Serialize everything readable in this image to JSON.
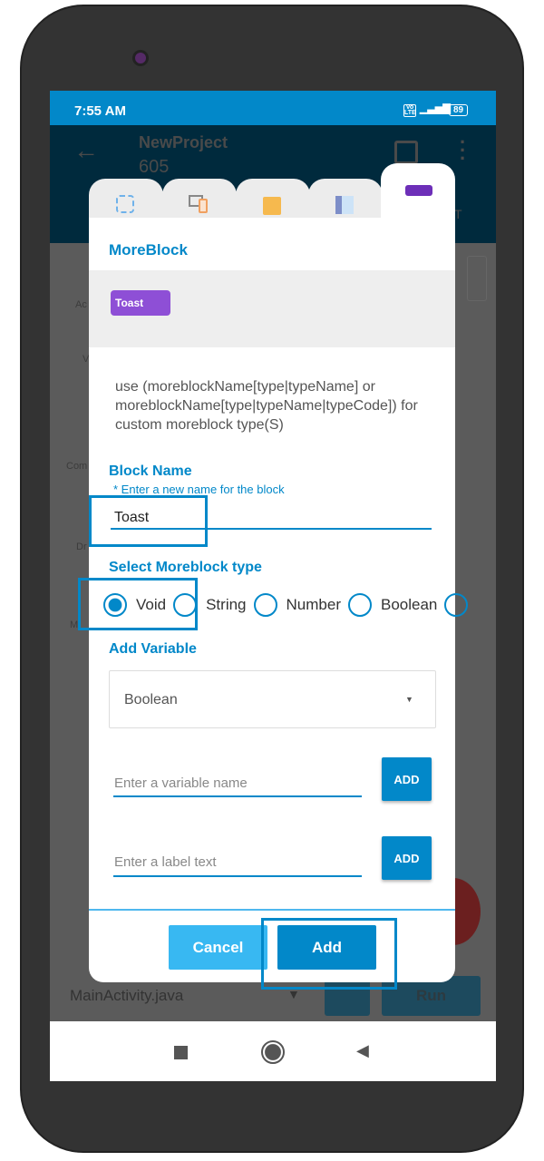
{
  "status": {
    "time": "7:55 AM",
    "volte": "Vo LTE",
    "battery": "89"
  },
  "appbar": {
    "title": "NewProject",
    "subtitle": "605",
    "tab_partial": "T"
  },
  "background_sidebar": [
    "Ac",
    "V",
    "Com",
    "Dr",
    "M"
  ],
  "bottom_bar": {
    "file": "MainActivity.java",
    "run": "Run"
  },
  "dialog": {
    "tabs": [
      {
        "icon": "refresh-icon"
      },
      {
        "icon": "devices-icon"
      },
      {
        "icon": "box-icon"
      },
      {
        "icon": "layout-icon"
      },
      {
        "icon": "moreblock-icon",
        "active": true
      }
    ],
    "title": "MoreBlock",
    "preview_block": "Toast",
    "description": "use (moreblockName[type|typeName] or moreblockName[type|typeName|typeCode]) for custom moreblock type(S)",
    "block_name_label": "Block Name",
    "block_name_hint": "* Enter a new name for the block",
    "block_name_value": "Toast",
    "type_label": "Select Moreblock type",
    "types": [
      {
        "label": "Void",
        "selected": true
      },
      {
        "label": "String",
        "selected": false
      },
      {
        "label": "Number",
        "selected": false
      },
      {
        "label": "Boolean",
        "selected": false
      }
    ],
    "add_variable_label": "Add Variable",
    "variable_type": "Boolean",
    "variable_name_placeholder": "Enter a variable name",
    "label_text_placeholder": "Enter a label text",
    "add_small": "ADD",
    "cancel": "Cancel",
    "add": "Add"
  },
  "colors": {
    "accent": "#0288c9",
    "cancel": "#38b8f2",
    "block": "#8e4fd6"
  }
}
